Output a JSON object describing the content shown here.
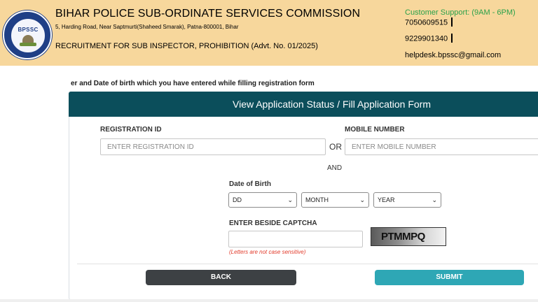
{
  "header": {
    "logo_text": "BPSSC",
    "title": "BIHAR POLICE SUB-ORDINATE SERVICES COMMISSION",
    "address": "5, Harding Road, Near Saptmurti(Shaheed Smarak), Patna-800001, Bihar",
    "recruitment": "RECRUITMENT FOR SUB INSPECTOR, PROHIBITION (Advt. No. 01/2025)",
    "support_label": "Customer Support: (9AM - 6PM)",
    "phone_1": "7050609515",
    "phone_2": "9229901340",
    "email": "helpdesk.bpssc@gmail.com"
  },
  "instruction": "er and Date of birth which you have entered while filling registration form",
  "form": {
    "title": "View Application Status / Fill Application Form",
    "registration_label": "REGISTRATION ID",
    "registration_placeholder": "ENTER REGISTRATION ID",
    "or_text": "OR",
    "mobile_label": "MOBILE NUMBER",
    "mobile_placeholder": "ENTER MOBILE NUMBER",
    "and_text": "AND",
    "dob_label": "Date of Birth",
    "dob_day": "DD",
    "dob_month": "MONTH",
    "dob_year": "YEAR",
    "captcha_label": "ENTER BESIDE CAPTCHA",
    "captcha_value": "",
    "captcha_hint": "(Letters are not case sensitive)",
    "captcha_text": "PTMMPQ",
    "back_label": "BACK",
    "submit_label": "SUBMIT"
  },
  "colors": {
    "header_bg": "#f7d79c",
    "form_header_bg": "#0b4e5b",
    "support_text": "#2aa14a",
    "back_button": "#3d4144",
    "submit_button": "#2ea7b5",
    "hint_text": "#e23b2b"
  },
  "icons": {
    "dropdown": "chevron-down-icon",
    "logo": "bpssc-emblem"
  }
}
